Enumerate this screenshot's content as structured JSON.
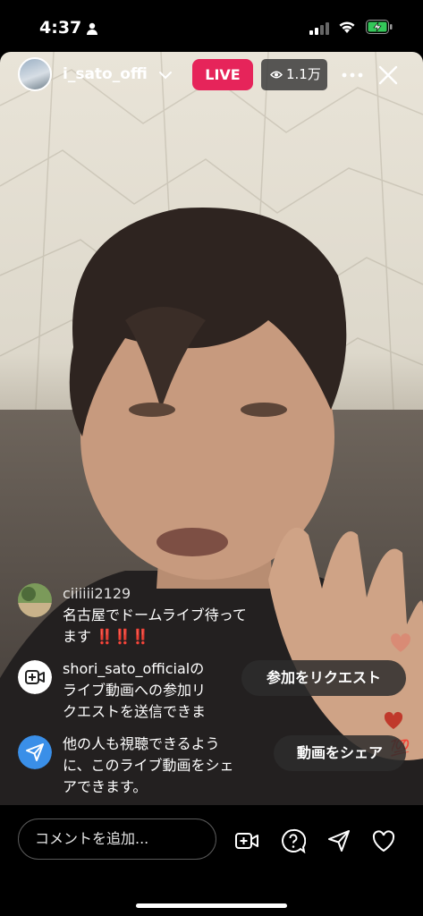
{
  "status_bar": {
    "time": "4:37"
  },
  "stream": {
    "host_name": "i_sato_offi",
    "live_label": "LIVE",
    "viewer_count": "1.1万"
  },
  "comments": [
    {
      "username": "ciiiiii2129",
      "line1": "名古屋でドームライブ待って",
      "line2": "ます",
      "emoji": "‼️‼️‼️"
    }
  ],
  "system_messages": [
    {
      "text_lines": [
        "shori_sato_officialの",
        "ライブ動画への参加リ",
        "クエストを送信できま"
      ],
      "button": "参加をリクエスト"
    },
    {
      "text_lines": [
        "他の人も視聴できるよう",
        "に、このライブ動画をシェ",
        "アできます。"
      ],
      "button": "動画をシェア"
    }
  ],
  "bottom_bar": {
    "comment_placeholder": "コメントを追加..."
  },
  "colors": {
    "live": "#e6245a",
    "share_blue": "#3a8fe8",
    "heart": "#c0392b"
  }
}
